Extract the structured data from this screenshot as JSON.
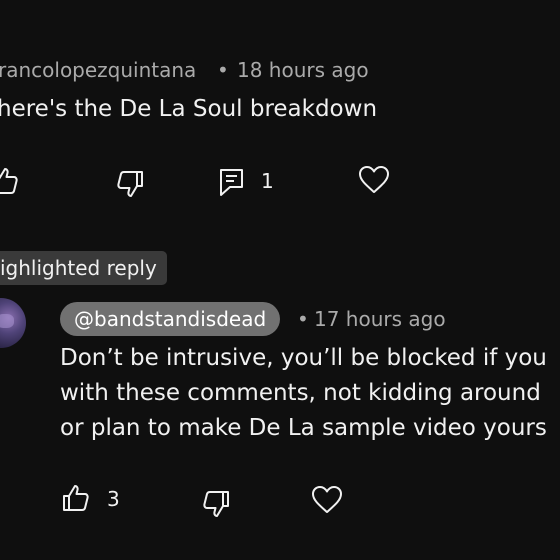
{
  "parent_comment": {
    "author": "rancolopezquintana",
    "separator": "•",
    "time": "18 hours ago",
    "text": "here's the De La Soul breakdown",
    "actions": {
      "like_icon": "thumbs-up-icon",
      "dislike_icon": "thumbs-down-icon",
      "reply_icon": "comment-icon",
      "reply_count": "1",
      "heart_icon": "heart-icon"
    }
  },
  "highlighted_label": "ighlighted reply",
  "reply": {
    "author": "@bandstandisdead",
    "separator": "•",
    "time": "17 hours ago",
    "text_lines": [
      "Don’t be intrusive, you’ll be blocked if you",
      "with these comments, not kidding around",
      "or plan to make De La sample video yours"
    ],
    "actions": {
      "like_icon": "thumbs-up-icon",
      "like_count": "3",
      "dislike_icon": "thumbs-down-icon",
      "heart_icon": "heart-icon"
    }
  },
  "colors": {
    "background": "#0f0f0f",
    "text": "#f1f1f1",
    "muted": "#aaaaaa",
    "badge": "#3a3a3a",
    "author_chip": "#717171"
  }
}
